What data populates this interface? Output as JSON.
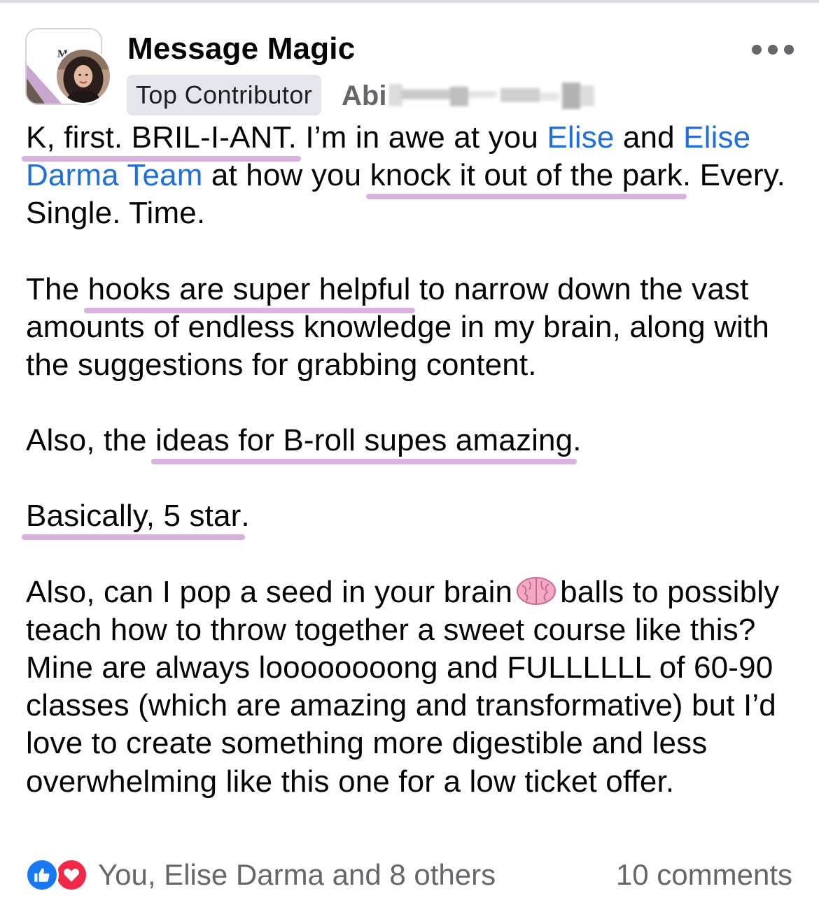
{
  "header": {
    "group_name": "Message Magic",
    "badge": "Top Contributor",
    "author_name": "Abi"
  },
  "body": {
    "p1": {
      "seg1": "K, first. BRIL-I-ANT.",
      "seg2": " I’m in awe at you ",
      "mention1": "Elise",
      "seg3": " and ",
      "mention2": "Elise Darma Team",
      "seg4": " at how you ",
      "seg5": "knock it out of the park",
      "seg6": ". Every. Single. Time."
    },
    "p2": {
      "seg1": "The ",
      "seg2": "hooks are super helpful",
      "seg3": " to narrow down the vast amounts of endless knowledge in my brain, along with the suggestions for grabbing content."
    },
    "p3": {
      "seg1": "Also, the ",
      "seg2": "ideas for B-roll supes amazing",
      "seg3": "."
    },
    "p4": {
      "seg1": "Basically, 5 star",
      "seg2": "."
    },
    "p5": {
      "seg1": "Also, can I pop a seed in your brain",
      "seg2": "balls to possibly teach how to throw together a sweet course like this? Mine are always loooooooong and FULLLLLL of 60-90 classes (which are amazing and transformative) but I’d love to create something more digestible and less overwhelming like this one for a low ticket offer."
    }
  },
  "footer": {
    "reactions_text": "You, Elise Darma and 8 others",
    "comments_text": "10 comments"
  },
  "icons": {
    "reactions": [
      "like-icon",
      "love-icon"
    ],
    "emoji": "brain-emoji",
    "more": "more-options-icon"
  },
  "colors": {
    "mention": "#216fdb",
    "highlight": "#d7b2dd",
    "like": "#1877f2",
    "love": "#f02849",
    "meta": "#65676b"
  }
}
